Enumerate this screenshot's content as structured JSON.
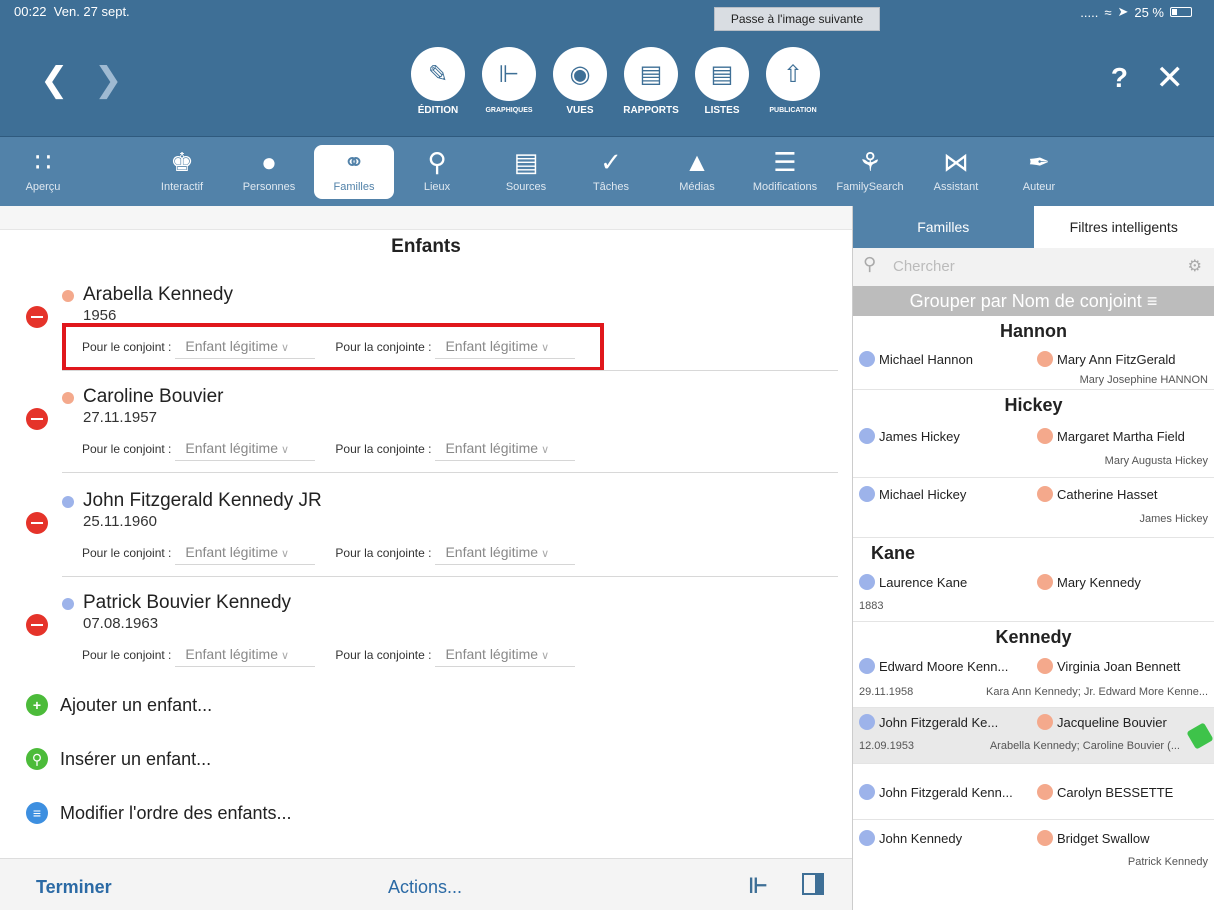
{
  "status": {
    "time": "00:22",
    "date": "Ven. 27 sept.",
    "battery": "25 %",
    "signal": "....."
  },
  "tooltip": "Passe à l'image suivante",
  "modes": [
    {
      "label": "ÉDITION",
      "icon": "pencil-icon"
    },
    {
      "label": "GRAPHIQUES",
      "icon": "chart-icon"
    },
    {
      "label": "VUES",
      "icon": "eye-icon"
    },
    {
      "label": "RAPPORTS",
      "icon": "report-icon"
    },
    {
      "label": "LISTES",
      "icon": "list-icon"
    },
    {
      "label": "PUBLICATION",
      "icon": "upload-icon"
    }
  ],
  "toolbar": [
    {
      "label": "Aperçu",
      "icon": "grid-icon"
    },
    {
      "label": "Interactif",
      "icon": "tree-icon"
    },
    {
      "label": "Personnes",
      "icon": "person-icon"
    },
    {
      "label": "Familles",
      "icon": "rings-icon"
    },
    {
      "label": "Lieux",
      "icon": "pin-icon"
    },
    {
      "label": "Sources",
      "icon": "documents-icon"
    },
    {
      "label": "Tâches",
      "icon": "check-icon"
    },
    {
      "label": "Médias",
      "icon": "media-icon"
    },
    {
      "label": "Modifications",
      "icon": "changes-icon"
    },
    {
      "label": "FamilySearch",
      "icon": "familysearch-icon"
    },
    {
      "label": "Assistant",
      "icon": "bowtie-icon"
    },
    {
      "label": "Auteur",
      "icon": "pen-icon"
    }
  ],
  "main": {
    "title": "Enfants",
    "spouse_label": "Pour le conjoint :",
    "spouse2_label": "Pour la conjointe :",
    "children": [
      {
        "name": "Arabella Kennedy",
        "date": "1956",
        "rel1": "Enfant légitime",
        "rel2": "Enfant légitime",
        "sex": "f"
      },
      {
        "name": "Caroline Bouvier",
        "date": "27.11.1957",
        "rel1": "Enfant légitime",
        "rel2": "Enfant légitime",
        "sex": "f"
      },
      {
        "name": "John Fitzgerald Kennedy JR",
        "date": "25.11.1960",
        "rel1": "Enfant légitime",
        "rel2": "Enfant légitime",
        "sex": "m"
      },
      {
        "name": "Patrick Bouvier Kennedy",
        "date": "07.08.1963",
        "rel1": "Enfant légitime",
        "rel2": "Enfant légitime",
        "sex": "m"
      }
    ],
    "actions": [
      "Ajouter un enfant...",
      "Insérer un enfant...",
      "Modifier l'ordre des enfants..."
    ]
  },
  "bottom": {
    "done": "Terminer",
    "actions": "Actions..."
  },
  "side": {
    "tab_families": "Familles",
    "tab_filters": "Filtres intelligents",
    "search_placeholder": "Chercher",
    "group_by": "Grouper par Nom de conjoint",
    "groups": [
      {
        "name": "Hannon",
        "families": [
          {
            "p1": "Michael Hannon",
            "p2": "Mary Ann FitzGerald",
            "date": "",
            "children": "Mary Josephine HANNON"
          }
        ]
      },
      {
        "name": "Hickey",
        "families": [
          {
            "p1": "James Hickey",
            "p2": "Margaret Martha Field",
            "date": "",
            "children": "Mary Augusta Hickey"
          },
          {
            "p1": "Michael Hickey",
            "p2": "Catherine Hasset",
            "date": "",
            "children": "James Hickey"
          }
        ]
      },
      {
        "name": "Kane",
        "families": [
          {
            "p1": "Laurence Kane",
            "p2": "Mary Kennedy",
            "date": "1883",
            "children": ""
          }
        ]
      },
      {
        "name": "Kennedy",
        "families": [
          {
            "p1": "Edward Moore Kenn...",
            "p2": "Virginia Joan Bennett",
            "date": "29.11.1958",
            "children": "Kara Ann Kennedy; Jr. Edward More Kenne..."
          },
          {
            "p1": "John Fitzgerald Ke...",
            "p2": "Jacqueline Bouvier",
            "date": "12.09.1953",
            "children": "Arabella Kennedy; Caroline Bouvier (..."
          },
          {
            "p1": "John Fitzgerald Kenn...",
            "p2": "Carolyn BESSETTE",
            "date": "",
            "children": ""
          },
          {
            "p1": "John Kennedy",
            "p2": "Bridget Swallow",
            "date": "",
            "children": "Patrick Kennedy"
          }
        ]
      }
    ]
  },
  "colors": {
    "header": "#3e6f96",
    "toolbar": "#5282a9",
    "male": "#9db3ea",
    "female": "#f4a98c",
    "remove": "#e5332a",
    "highlight": "#e0171c"
  }
}
